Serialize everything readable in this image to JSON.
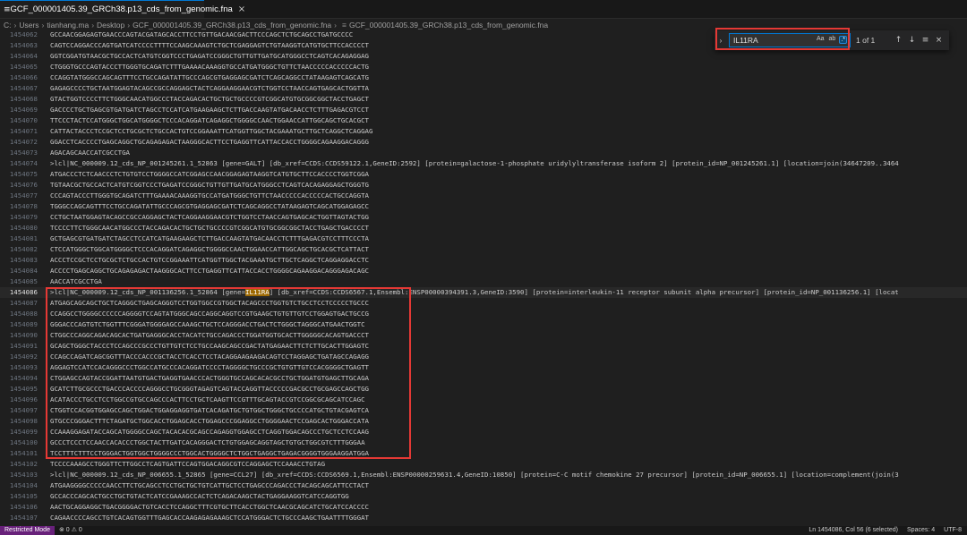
{
  "tab": {
    "label": "GCF_000001405.39_GRCh38.p13_cds_from_genomic.fna",
    "icon": "file-lines-icon",
    "close": "×"
  },
  "breadcrumb": [
    "C:",
    "Users",
    "tianhang.ma",
    "Desktop",
    "GCF_000001405.39_GRCh38.p13_cds_from_genomic.fna",
    "GCF_000001405.39_GRCh38.p13_cds_from_genomic.fna"
  ],
  "find": {
    "value": "IL11RA",
    "opt_case": "Aa",
    "opt_word": "ab",
    "opt_regex": ".*",
    "match_count": "1 of 1",
    "prev": "↑",
    "next": "↓",
    "in_selection": "≡",
    "close": "×",
    "toggle": "›"
  },
  "lines": [
    {
      "n": "1454062",
      "t": "GCCAACGGAGAGTGAACCCAGTACGATAGCACCTTCCTGTTGACAACGACTTCCCAGCTCTGCAGCCTGATGCCCC"
    },
    {
      "n": "1454063",
      "t": "CAGTCCAGGACCCAGTGATCATCCCCTTTTCCAAGCAAAGTCTGCTCGAGGAGTCTGTAAGGTCATGTGCTTCCACCCCT"
    },
    {
      "n": "1454064",
      "t": "GGTCGGATGTAACGCTGCCACTCATGTCGGTCCCTGAGATCCGGGCTGTTGTTGATGCATGGGCCTCAGTCACAGAGGAG"
    },
    {
      "n": "1454065",
      "t": "CTGGGTGCCCAGTACCCTTGGGTGCAGATCTTTGAAAACAAAGGTGCCATGATGGGCTGTTCTAACCCCCACCCCCACTG"
    },
    {
      "n": "1454066",
      "t": "CCAGGTATGGGCCAGCAGTTTCCTGCCAGATATTGCCCAGCGTGAGGAGCGATCTCAGCAGGCCTATAAGAGTCAGCATG"
    },
    {
      "n": "1454067",
      "t": "GAGAGCCCCTGCTAATGGAGTACAGCCGCCAGGAGCTACTCAGGAAGGAACGTCTGGTCCTAACCAGTGAGCACTGGTTA"
    },
    {
      "n": "1454068",
      "t": "GTACTGGTCCCCTTCTGGGCAACATGGCCCTACCAGACACTGCTGCTGCCCCGTCGGCATGTGCGGCGGCTACCTGAGCT"
    },
    {
      "n": "1454069",
      "t": "GACCCCTGCTGAGCGTGATGATCTAGCCTCCATCATGAAGAAGCTCTTGACCAAGTATGACAACCTCTTTGAGACGTCCT"
    },
    {
      "n": "1454070",
      "t": "TTCCCTACTCCATGGGCTGGCATGGGGCTCCCACAGGATCAGAGGCTGGGGCCAACTGGAACCATTGGCAGCTGCACGCT"
    },
    {
      "n": "1454071",
      "t": "CATTACTACCCTCCGCTCCTGCGCTCTGCCACTGTCCGGAAATTCATGGTTGGCTACGAAATGCTTGCTCAGGCTCAGGAG"
    },
    {
      "n": "1454072",
      "t": "GGACCTCACCCCTGAGCAGGCTGCAGAGAGACTAAGGGCACTTCCTGAGGTTCATTACCACCTGGGGCAGAAGGACAGGG"
    },
    {
      "n": "1454073",
      "t": "AGACAGCAACCATCGCCTGA"
    },
    {
      "n": "1454074",
      "t": ">lcl|NC_000009.12_cds_NP_001245261.1_52863 [gene=GALT] [db_xref=CCDS:CCDS59122.1,GeneID:2592] [protein=galactose-1-phosphate uridylyltransferase isoform 2] [protein_id=NP_001245261.1] [location=join(34647209..3464"
    },
    {
      "n": "1454075",
      "t": "ATGACCCTCTCAACCCTCTGTGTCCTGGGGCCATCGGAGCCAACGGAGAGTAAGGTCATGTGCTTCCACCCCTGGTCGGA"
    },
    {
      "n": "1454076",
      "t": "TGTAACGCTGCCACTCATGTCGGTCCCTGAGATCCGGGCTGTTGTTGATGCATGGGCCTCAGTCACAGAGGAGCTGGGTG"
    },
    {
      "n": "1454077",
      "t": "CCCAGTACCCTTGGGTGCAGATCTTTGAAAACAAAGGTGCCATGATGGGCTGTTCTAACCCCCACCCCCACTGCCAGGTA"
    },
    {
      "n": "1454078",
      "t": "TGGGCCAGCAGTTTCCTGCCAGATATTGCCCAGCGTGAGGAGCGATCTCAGCAGGCCTATAAGAGTCAGCATGGAGAGCC"
    },
    {
      "n": "1454079",
      "t": "CCTGCTAATGGAGTACAGCCGCCAGGAGCTACTCAGGAAGGAACGTCTGGTCCTAACCAGTGAGCACTGGTTAGTACTGG"
    },
    {
      "n": "1454080",
      "t": "TCCCCTTCTGGGCAACATGGCCCTACCAGACACTGCTGCTGCCCCGTCGGCATGTGCGGCGGCTACCTGAGCTGACCCCT"
    },
    {
      "n": "1454081",
      "t": "GCTGAGCGTGATGATCTAGCCTCCATCATGAAGAAGCTCTTGACCAAGTATGACAACCTCTTTGAGACGTCCTTTCCCTA"
    },
    {
      "n": "1454082",
      "t": "CTCCATGGGCTGGCATGGGGCTCCCACAGGATCAGAGGCTGGGGCCAACTGGAACCATTGGCAGCTGCACGCTCATTACT"
    },
    {
      "n": "1454083",
      "t": "ACCCTCCGCTCCTGCGCTCTGCCACTGTCCGGAAATTCATGGTTGGCTACGAAATGCTTGCTCAGGCTCAGGAGGACCTC"
    },
    {
      "n": "1454084",
      "t": "ACCCCTGAGCAGGCTGCAGAGAGACTAAGGGCACTTCCTGAGGTTCATTACCACCTGGGGCAGAAGGACAGGGAGACAGC"
    },
    {
      "n": "1454085",
      "t": "AACCATCGCCTGA"
    },
    {
      "n": "1454086",
      "t": ">lcl|NC_000009.12_cds_NP_001136256.1_52864 [gene=IL11RA] [db_xref=CCDS:CCDS6567.1,Ensembl:ENSP00000394391.3,GeneID:3590] [protein=interleukin-11 receptor subunit alpha precursor] [protein_id=NP_001136256.1] [locat",
      "current": true,
      "pre": ">lcl|NC_000009.12_cds_NP_001136256.1_52864 [gene=",
      "match": "IL11RA",
      "post": "] [db_xref=CCDS:CCDS6567.1,Ensembl:ENSP00000394391.3,GeneID:3590] [protein=interleukin-11 receptor subunit alpha precursor] [protein_id=NP_001136256.1] [locat"
    },
    {
      "n": "1454087",
      "t": "ATGAGCAGCAGCTGCTCAGGGCTGAGCAGGGTCCTGGTGGCCGTGGCTACAGCCCTGGTGTCTGCCTCCTCCCCCTGCCC"
    },
    {
      "n": "1454088",
      "t": "CCAGGCCTGGGGCCCCCCAGGGGTCCAGTATGGGCAGCCAGGCAGGTCCGTGAAGCTGTGTTGTCCTGGAGTGACTGCCG"
    },
    {
      "n": "1454089",
      "t": "GGGACCCAGTGTCTGGTTTCGGGATGGGGAGCCAAAGCTGCTCCAGGGACCTGACTCTGGGCTAGGGCATGAACTGGTC"
    },
    {
      "n": "1454090",
      "t": "CTGGCCCAGGCAGACAGCACTGATGAGGGCACCTACATCTGCCAGACCCTGGATGGTGCACTTGGGGGCACAGTGACCCT"
    },
    {
      "n": "1454091",
      "t": "GCAGCTGGGCTACCCTCCAGCCCGCCCTGTTGTCTCCTGCCAAGCAGCCGACTATGAGAACTTCTCTTGCACTTGGAGTC"
    },
    {
      "n": "1454092",
      "t": "CCAGCCAGATCAGCGGTTTACCCACCCGCTACCTCACCTCCTACAGGAAGAAGACAGTCCTAGGAGCTGATAGCCAGAGG"
    },
    {
      "n": "1454093",
      "t": "AGGAGTCCATCCACAGGGCCCTGGCCATGCCCACAGGATCCCCTAGGGGCTGCCCGCTGTGTTGTCCACGGGGCTGAGTT"
    },
    {
      "n": "1454094",
      "t": "CTGGAGCCAGTACCGGATTAATGTGACTGAGGTGAACCCACTGGGTGCCAGCACACGCCTGCTGGATGTGAGCTTGCAGA"
    },
    {
      "n": "1454095",
      "t": "GCATCTTGCGCCCTGACCCACCCCAGGGCCTGCGGGTAGAGTCAGTACCAGGTTACCCCCGACGCCTGCGAGCCAGCTGG"
    },
    {
      "n": "1454096",
      "t": "ACATACCCTGCCTCCTGGCCGTGCCAGCCCACTTCCTGCTCAAGTTCCGTTTGCAGTACCGTCCGGCGCAGCATCCAGC"
    },
    {
      "n": "1454097",
      "t": "CTGGTCCACGGTGGAGCCAGCTGGACTGGAGGAGGTGATCACAGATGCTGTGGCTGGGCTGCCCCATGCTGTACGAGTCA"
    },
    {
      "n": "1454098",
      "t": "GTGCCCGGGACTTTCTAGATGCTGGCACCTGGAGCACCTGGAGCCCGGAGGCCTGGGGAACTCCGAGCACTGGGACCATA"
    },
    {
      "n": "1454099",
      "t": "CCAAAGGAGATACCAGCATGGGGCCAGCTACACACGCAGCCAGAGGTGGAGCCTCAGGTGGACAGCCCTGCTCCTCCAAG"
    },
    {
      "n": "1454100",
      "t": "GCCCTCCCTCCAACCACACCCTGGCTACTTGATCACAGGGACTCTGTGGAGCAGGTAGCTGTGCTGGCGTCTTTGGGAA"
    },
    {
      "n": "1454101",
      "t": "TCCTTTCTTTCCTGGGACTGGTGGCTGGGGCCCTGGCACTGGGGCTCTGGCTGAGGCTGAGACGGGGTGGGAAGGATGGA"
    },
    {
      "n": "1454102",
      "t": "TCCCCAAAGCCTGGGTTCTTGGCCTCAGTGATTCCAGTGGACAGGCGTCCAGGAGCTCCAAACCTGTAG"
    },
    {
      "n": "1454103",
      "t": ">lcl|NC_000009.12_cds_NP_006655.1_52865 [gene=CCL27] [db_xref=CCDS:CCDS6569.1,Ensembl:ENSP00000259631.4,GeneID:10850] [protein=C-C motif chemokine 27 precursor] [protein_id=NP_006655.1] [location=complement(join(3"
    },
    {
      "n": "1454104",
      "t": "ATGAAGGGGCCCCCAACCTTCTGCAGCCTCCTGCTGCTGTCATTGCTCCTGAGCCCAGACCCTACAGCAGCATTCCTACT"
    },
    {
      "n": "1454105",
      "t": "GCCACCCAGCACTGCCTGCTGTACTCATCCGAAAGCCACTCTCAGACAAGCTACTGAGGAAGGTCATCCAGGTGG"
    },
    {
      "n": "1454106",
      "t": "AACTGCAGGAGGCTGACGGGGACTGTCACCTCCAGGCTTTCGTGCTTCACCTGGCTCAACGCAGCATCTGCATCCACCCC"
    },
    {
      "n": "1454107",
      "t": "CAGAACCCCAGCCTGTCACAGTGGTTTGAGCACCAAGAGAGAAAGCTCCATGGGACTCTGCCCAAGCTGAATTTTGGGAT"
    },
    {
      "n": "1454108",
      "t": "GCTAAGGAAAATGGGCTGA"
    },
    {
      "n": "1454109",
      "t": ">lcl|NC_000009.12_cds_XP_016870595.1_52866 [gene=LOC730098] [db_xref=GeneID:730098] [protein=uncharacterized protein LOC730098 isoform X1] [protein_id=XP_016870595.1] [location=complement(join(34665034..34665190,3"
    }
  ],
  "status": {
    "mode": "Restricted Mode",
    "problems": "⊗ 0 ⚠ 0",
    "position": "Ln 1454086, Col 56 (6 selected)",
    "spaces": "Spaces: 4",
    "encoding": "UTF-8"
  }
}
